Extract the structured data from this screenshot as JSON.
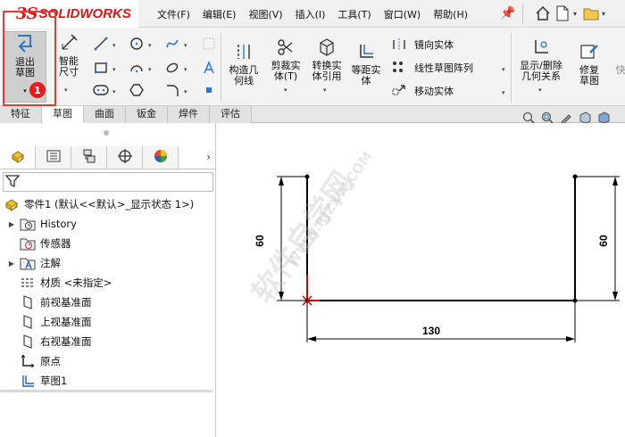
{
  "app": {
    "logo_ds": "3S",
    "logo_text": "SOLIDWORKS"
  },
  "menu": [
    "文件(F)",
    "编辑(E)",
    "视图(V)",
    "插入(I)",
    "工具(T)",
    "窗口(W)",
    "帮助(H)"
  ],
  "command_manager": {
    "exit_sketch": "退出草图",
    "smart_dimension": "智能尺寸",
    "construction_geometry": "构造几何线",
    "trim_entities": "剪裁实体(T)",
    "convert_entities": "转换实体引用",
    "offset_entities": "等距实体",
    "mirror_entities": "镜向实体",
    "linear_sketch_pattern": "线性草图阵列",
    "move_entities": "移动实体",
    "display_delete_relations": "显示/删除几何关系",
    "repair_sketch": "修复草图",
    "quick": "快"
  },
  "annotation_badge": "1",
  "tabs": [
    "特征",
    "草图",
    "曲面",
    "钣金",
    "焊件",
    "评估"
  ],
  "active_tab_index": 1,
  "tree": {
    "root": "零件1 (默认<<默认>_显示状态 1>)",
    "items": [
      {
        "label": "History",
        "expandable": true,
        "icon": "history-icon"
      },
      {
        "label": "传感器",
        "expandable": false,
        "icon": "sensor-icon"
      },
      {
        "label": "注解",
        "expandable": true,
        "icon": "annotation-icon"
      },
      {
        "label": "材质 <未指定>",
        "expandable": false,
        "icon": "material-icon"
      },
      {
        "label": "前视基准面",
        "expandable": false,
        "icon": "plane-icon"
      },
      {
        "label": "上视基准面",
        "expandable": false,
        "icon": "plane-icon"
      },
      {
        "label": "右视基准面",
        "expandable": false,
        "icon": "plane-icon"
      },
      {
        "label": "原点",
        "expandable": false,
        "icon": "origin-icon"
      },
      {
        "label": "草图1",
        "expandable": false,
        "icon": "sketch-icon"
      }
    ]
  },
  "sketch": {
    "dim_left": "60",
    "dim_right": "60",
    "dim_bottom": "130"
  },
  "watermark": {
    "cn": "软件自学网",
    "url": "WWW.RJZXW.COM"
  },
  "colors": {
    "accent_red": "#e02020",
    "brand_red": "#d01818",
    "sketch_line": "#000000",
    "origin_red": "#d00000"
  }
}
